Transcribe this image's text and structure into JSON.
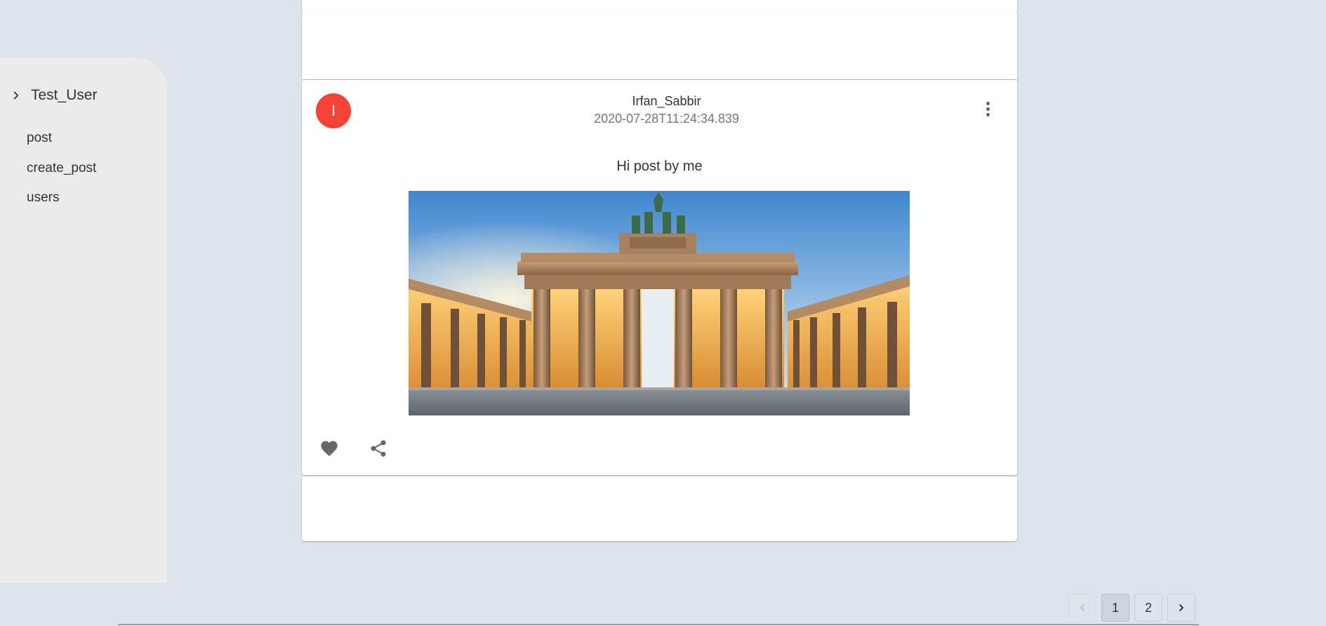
{
  "sidebar": {
    "user_label": "Test_User",
    "items": [
      {
        "label": "post"
      },
      {
        "label": "create_post"
      },
      {
        "label": "users"
      }
    ]
  },
  "post": {
    "avatar_letter": "I",
    "author": "Irfan_Sabbir",
    "timestamp": "2020-07-28T11:24:34.839",
    "text": "Hi post by me",
    "avatar_color": "#f44336"
  },
  "pagination": {
    "pages": [
      "1",
      "2"
    ],
    "current": "1"
  },
  "icons": {
    "expand": "chevron-right-icon",
    "more": "more-vertical-icon",
    "like": "heart-icon",
    "share": "share-icon",
    "prev": "chevron-left-icon",
    "next": "chevron-right-icon"
  }
}
